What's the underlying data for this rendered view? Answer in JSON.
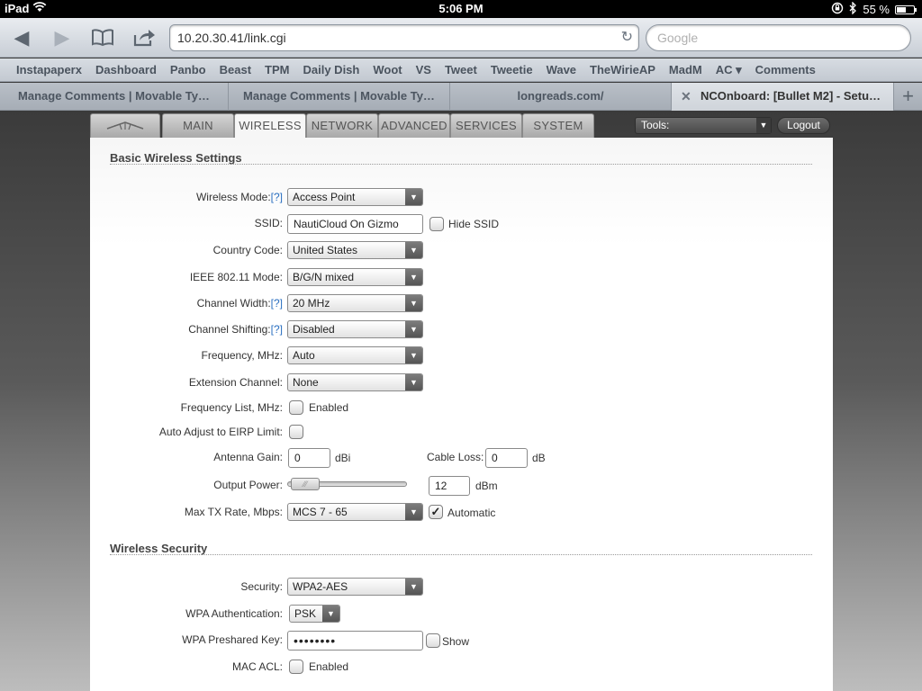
{
  "status_bar": {
    "device": "iPad",
    "time": "5:06 PM",
    "battery": "55 %",
    "battery_level": 0.55
  },
  "browser": {
    "url": "10.20.30.41/link.cgi",
    "search_placeholder": "Google",
    "bookmarks": [
      "Instapaperx",
      "Dashboard",
      "Panbo",
      "Beast",
      "TPM",
      "Daily Dish",
      "Woot",
      "VS",
      "Tweet",
      "Tweetie",
      "Wave",
      "TheWirieAP",
      "MadM",
      "AC ▾",
      "Comments"
    ],
    "tabs": [
      {
        "label": "Manage Comments | Movable Ty…"
      },
      {
        "label": "Manage Comments | Movable Ty…"
      },
      {
        "label": "longreads.com/"
      },
      {
        "label": "NCOnboard: [Bullet M2] - Setu…"
      }
    ]
  },
  "device_nav": {
    "tabs": [
      "MAIN",
      "WIRELESS",
      "NETWORK",
      "ADVANCED",
      "SERVICES",
      "SYSTEM"
    ],
    "active": "WIRELESS",
    "tools_label": "Tools:",
    "logout_label": "Logout"
  },
  "basic": {
    "title": "Basic Wireless Settings",
    "help": "[?]",
    "wireless_mode": {
      "label": "Wireless Mode:",
      "value": "Access Point"
    },
    "ssid": {
      "label": "SSID:",
      "value": "NautiCloud On Gizmo",
      "hide_label": "Hide SSID"
    },
    "country": {
      "label": "Country Code:",
      "value": "United States"
    },
    "ieee_mode": {
      "label": "IEEE 802.11 Mode:",
      "value": "B/G/N mixed"
    },
    "channel_width": {
      "label": "Channel Width:",
      "value": "20 MHz"
    },
    "channel_shifting": {
      "label": "Channel Shifting:",
      "value": "Disabled"
    },
    "frequency": {
      "label": "Frequency, MHz:",
      "value": "Auto"
    },
    "extension_channel": {
      "label": "Extension Channel:",
      "value": "None"
    },
    "frequency_list": {
      "label": "Frequency List, MHz:",
      "enabled_label": "Enabled"
    },
    "auto_adjust": {
      "label": "Auto Adjust to EIRP Limit:"
    },
    "antenna_gain": {
      "label": "Antenna Gain:",
      "value": "0",
      "unit": "dBi"
    },
    "cable_loss": {
      "label": "Cable Loss:",
      "value": "0",
      "unit": "dB"
    },
    "output_power": {
      "label": "Output Power:",
      "value": "12",
      "unit": "dBm",
      "slider_fraction": 0.04
    },
    "max_tx_rate": {
      "label": "Max TX Rate, Mbps:",
      "value": "MCS 7 - 65",
      "auto_label": "Automatic",
      "auto_checked": "✓"
    }
  },
  "security": {
    "title": "Wireless Security",
    "security": {
      "label": "Security:",
      "value": "WPA2-AES"
    },
    "wpa_auth": {
      "label": "WPA Authentication:",
      "value": "PSK"
    },
    "wpa_key": {
      "label": "WPA Preshared Key:",
      "value": "••••••••",
      "show_label": "Show"
    },
    "mac_acl": {
      "label": "MAC ACL:",
      "enabled_label": "Enabled"
    }
  }
}
